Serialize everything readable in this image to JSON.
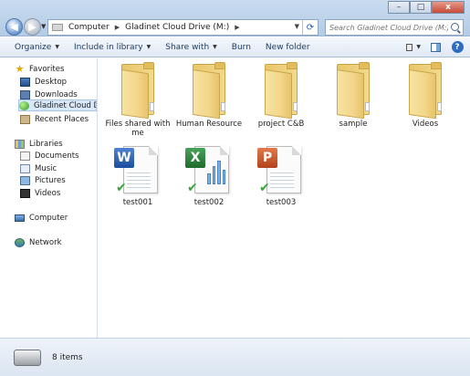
{
  "window": {
    "minimize_label": "–",
    "maximize_label": "□",
    "close_label": "x"
  },
  "address": {
    "crumbs": [
      "Computer",
      "Gladinet Cloud Drive (M:)"
    ]
  },
  "search": {
    "placeholder": "Search Gladinet Cloud Drive (M:)"
  },
  "toolbar": {
    "organize": "Organize",
    "include": "Include in library",
    "share": "Share with",
    "burn": "Burn",
    "new_folder": "New folder"
  },
  "nav": {
    "favorites": "Favorites",
    "desktop": "Desktop",
    "downloads": "Downloads",
    "cloud": "Gladinet Cloud Drive",
    "recent": "Recent Places",
    "libraries": "Libraries",
    "documents": "Documents",
    "music": "Music",
    "pictures": "Pictures",
    "videos": "Videos",
    "computer": "Computer",
    "network": "Network"
  },
  "items": [
    {
      "label": "Files shared with me",
      "type": "folder"
    },
    {
      "label": "Human Resource",
      "type": "folder"
    },
    {
      "label": "project C&B",
      "type": "folder"
    },
    {
      "label": "sample",
      "type": "folder"
    },
    {
      "label": "Videos",
      "type": "folder"
    },
    {
      "label": "test001",
      "type": "word",
      "badge": "W"
    },
    {
      "label": "test002",
      "type": "excel",
      "badge": "X"
    },
    {
      "label": "test003",
      "type": "powerpoint",
      "badge": "P"
    }
  ],
  "status": {
    "count": "8 items"
  }
}
